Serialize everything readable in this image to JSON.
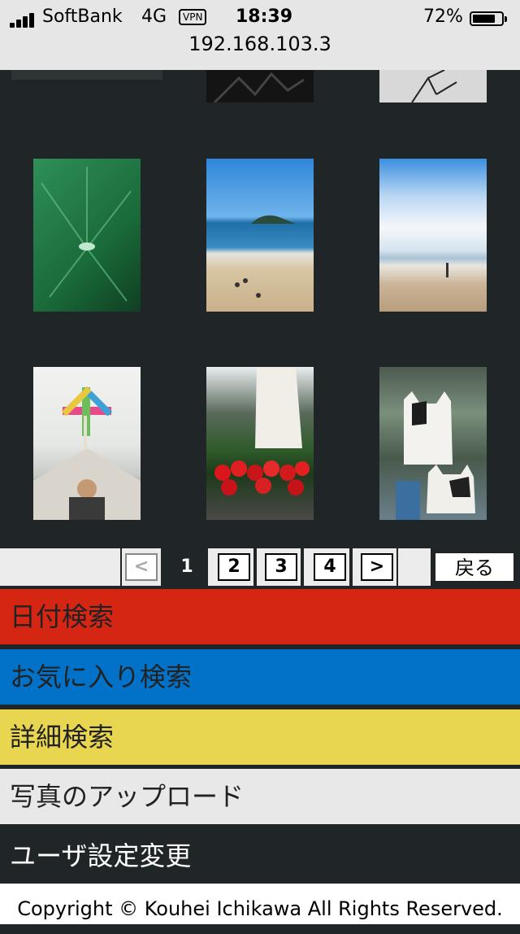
{
  "status_bar": {
    "carrier": "SoftBank",
    "network": "4G",
    "vpn": "VPN",
    "time": "18:39",
    "battery_percent": "72%",
    "battery_level": 0.72
  },
  "address_bar": {
    "url": "192.168.103.3"
  },
  "gallery": {
    "photos": [
      {
        "name": "lotus-leaf-photo"
      },
      {
        "name": "beach-island-photo"
      },
      {
        "name": "beach-clouds-photo"
      },
      {
        "name": "boy-pinwheel-photo"
      },
      {
        "name": "statue-roses-photo"
      },
      {
        "name": "cats-photo"
      }
    ]
  },
  "pagination": {
    "prev": "<",
    "current": "1",
    "pages": [
      "2",
      "3",
      "4"
    ],
    "next": ">",
    "back": "戻る"
  },
  "menu": {
    "items": [
      {
        "label": "日付検索",
        "color": "#d52613"
      },
      {
        "label": "お気に入り検索",
        "color": "#0272c9"
      },
      {
        "label": "詳細検索",
        "color": "#e8d650"
      },
      {
        "label": "写真のアップロード",
        "color": "#e8e8e8"
      },
      {
        "label": "ユーザ設定変更",
        "color": "#202627"
      }
    ]
  },
  "footer": {
    "copyright": "Copyright © Kouhei Ichikawa All Rights Reserved."
  }
}
